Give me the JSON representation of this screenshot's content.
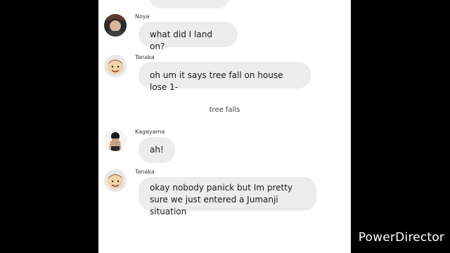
{
  "chat": {
    "messages": [
      {
        "sender": "Noya",
        "avatar": "noya-avatar",
        "text": "what did I land on?"
      },
      {
        "sender": "Tanaka",
        "avatar": "tanaka-avatar",
        "text": "oh um it says tree fall on house lose 1-"
      },
      {
        "sender": "Kageyama",
        "avatar": "kageyama-avatar",
        "text": "ah!"
      },
      {
        "sender": "Tanaka",
        "avatar": "tanaka-avatar",
        "text": "okay nobody panick but Im pretty sure we just entered a Jumanji situation"
      }
    ],
    "system_message": "tree falls"
  },
  "watermark": "PowerDirector",
  "colors": {
    "bubble": "#ececec",
    "background": "#ffffff",
    "letterbox": "#000000"
  }
}
